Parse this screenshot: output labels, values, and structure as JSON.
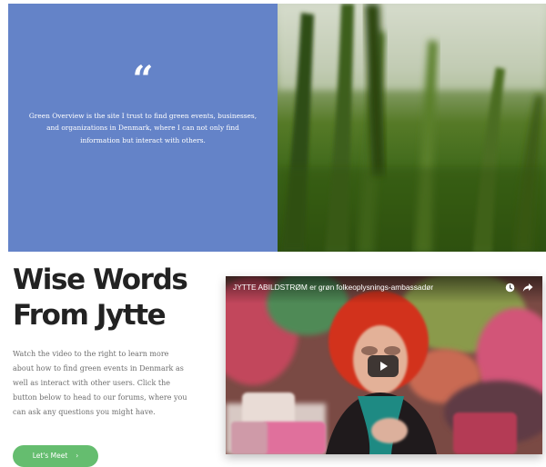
{
  "testimonial": {
    "quote_mark": "“",
    "quote_lines": [
      "Green Overview is the site I trust to find green events, businesses,",
      "and organizations in Denmark, where I can not only find",
      "information but interact with others."
    ]
  },
  "section": {
    "heading_lines": [
      "Wise Words",
      "From Jytte"
    ],
    "body_lines": [
      "Watch the video to the right to learn more",
      "about how to find green events in Denmark as",
      "well as interact with other users. Click the",
      "button below to head to our forums, where you",
      "can ask any questions you might have."
    ],
    "button_label": "Let's Meet",
    "button_chevron": "›"
  },
  "video": {
    "title": "JYTTE ABILDSTRØM er grøn folkeoplysnings-ambassadør",
    "icons": [
      "clock-icon",
      "share-icon",
      "play-icon"
    ]
  },
  "colors": {
    "quote_panel": "#6483c8",
    "button": "#65bd6f",
    "heading": "#222222",
    "body_text": "#6d6d6d"
  }
}
